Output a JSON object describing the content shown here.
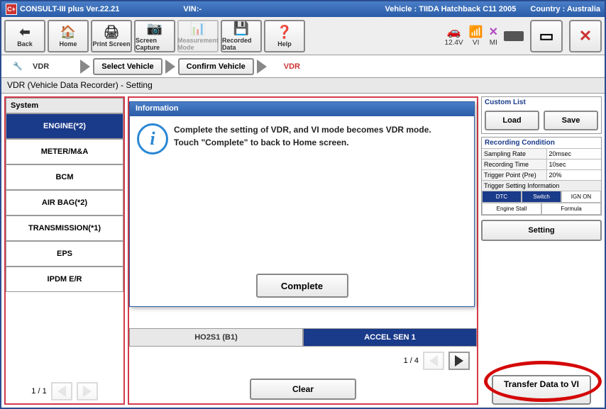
{
  "titlebar": {
    "app": "CONSULT-III plus  Ver.22.21",
    "vin": "VIN:-",
    "vehicle": "Vehicle : TIIDA Hatchback C11 2005",
    "country": "Country : Australia"
  },
  "toolbar": {
    "back": "Back",
    "home": "Home",
    "print": "Print Screen",
    "capture": "Screen Capture",
    "measure": "Measurement Mode",
    "recorded": "Recorded Data",
    "help": "Help"
  },
  "status": {
    "voltage": "12.4V",
    "vi": "VI",
    "mi": "MI"
  },
  "breadcrumb": {
    "section": "VDR",
    "step1": "Select Vehicle",
    "step2": "Confirm Vehicle",
    "current": "VDR"
  },
  "page_title": "VDR (Vehicle Data Recorder) - Setting",
  "system": {
    "header": "System",
    "items": [
      "ENGINE(*2)",
      "METER/M&A",
      "BCM",
      "AIR BAG(*2)",
      "TRANSMISSION(*1)",
      "EPS",
      "IPDM E/R"
    ],
    "selected_index": 0,
    "pager": "1 / 1"
  },
  "center": {
    "row_left": "HO2S1 (B1)",
    "row_right": "ACCEL SEN 1",
    "pager": "1 / 4",
    "clear": "Clear"
  },
  "right": {
    "custom_list": {
      "title": "Custom List",
      "load": "Load",
      "save": "Save"
    },
    "recording": {
      "title": "Recording Condition",
      "rows": [
        {
          "k": "Sampling Rate",
          "v": "20msec"
        },
        {
          "k": "Recording Time",
          "v": "10sec"
        },
        {
          "k": "Trigger Point (Pre)",
          "v": "20%"
        }
      ],
      "sub": "Trigger Setting Information",
      "btns": [
        "DTC",
        "Switch",
        "IGN ON"
      ],
      "btns2": [
        "Engine Stall",
        "Formula"
      ],
      "setting": "Setting"
    },
    "transfer": "Transfer Data to VI"
  },
  "modal": {
    "title": "Information",
    "line1": "Complete the setting of VDR, and VI mode becomes VDR mode.",
    "line2": "Touch \"Complete\" to back to Home screen.",
    "button": "Complete"
  }
}
